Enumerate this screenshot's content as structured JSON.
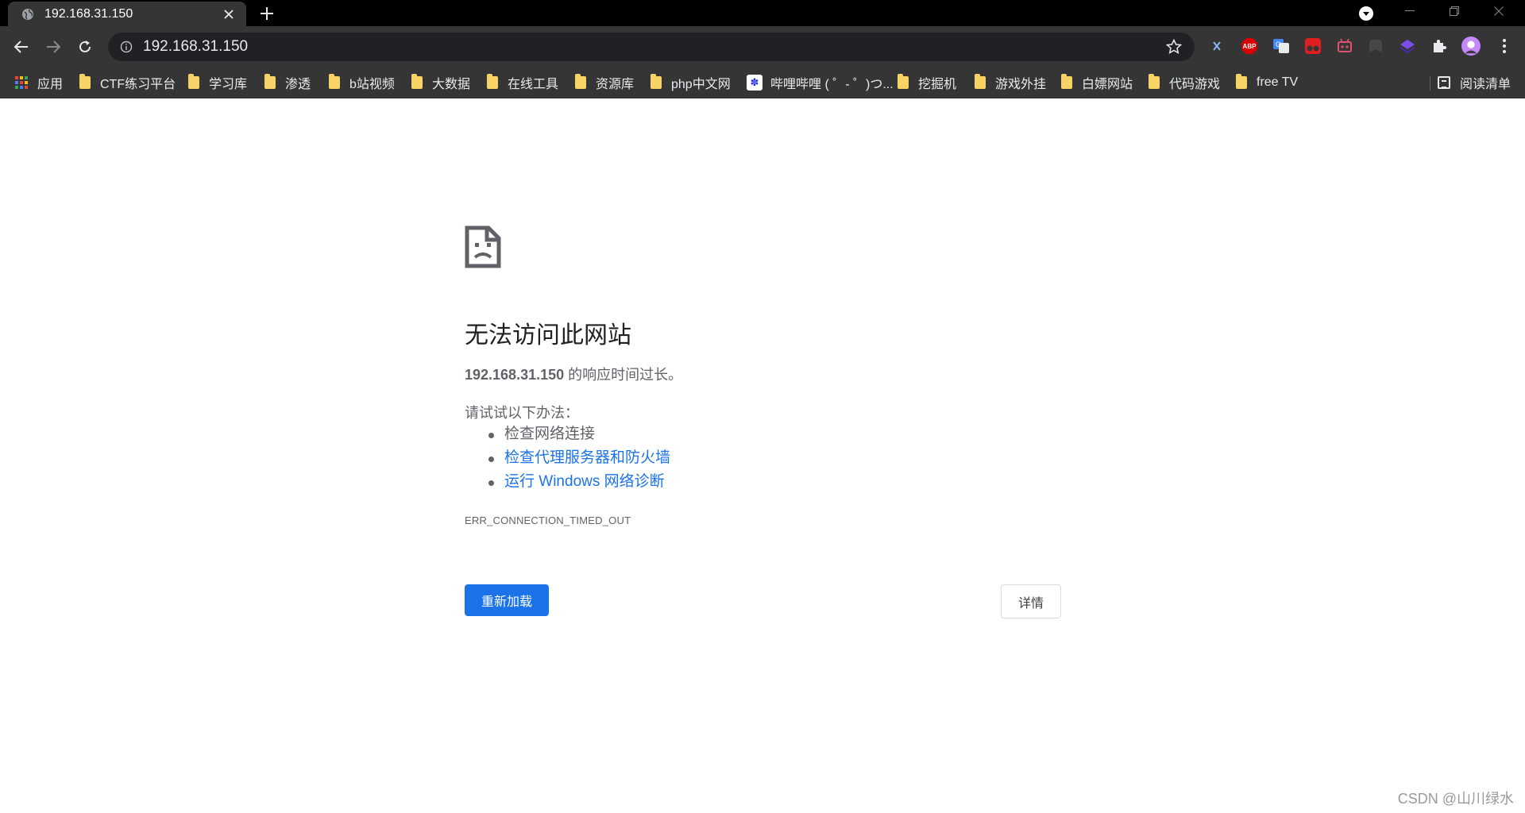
{
  "tab": {
    "title": "192.168.31.150"
  },
  "omnibox": {
    "url": "192.168.31.150"
  },
  "bookmarks": {
    "apps": "应用",
    "items": [
      "CTF练习平台",
      "学习库",
      "渗透",
      "b站视频",
      "大数据",
      "在线工具",
      "资源库",
      "php中文网",
      "哔哩哔哩 ( ゜- ゜)つ...",
      "挖掘机",
      "游戏外挂",
      "白嫖网站",
      "代码游戏",
      "free TV"
    ],
    "reading_list": "阅读清单"
  },
  "extensions": {
    "abp": "ABP"
  },
  "error_page": {
    "title": "无法访问此网站",
    "host": "192.168.31.150",
    "summary_suffix": " 的响应时间过长。",
    "suggest_heading": "请试试以下办法：",
    "suggestions": [
      "检查网络连接",
      "检查代理服务器和防火墙",
      "运行 Windows 网络诊断"
    ],
    "error_code": "ERR_CONNECTION_TIMED_OUT",
    "reload_label": "重新加载",
    "details_label": "详情"
  },
  "watermark": "CSDN @山川绿水",
  "colors": {
    "accent": "#1a73e8",
    "toolbar": "#353535",
    "tabstrip": "#000000",
    "folder": "#f7d264"
  }
}
